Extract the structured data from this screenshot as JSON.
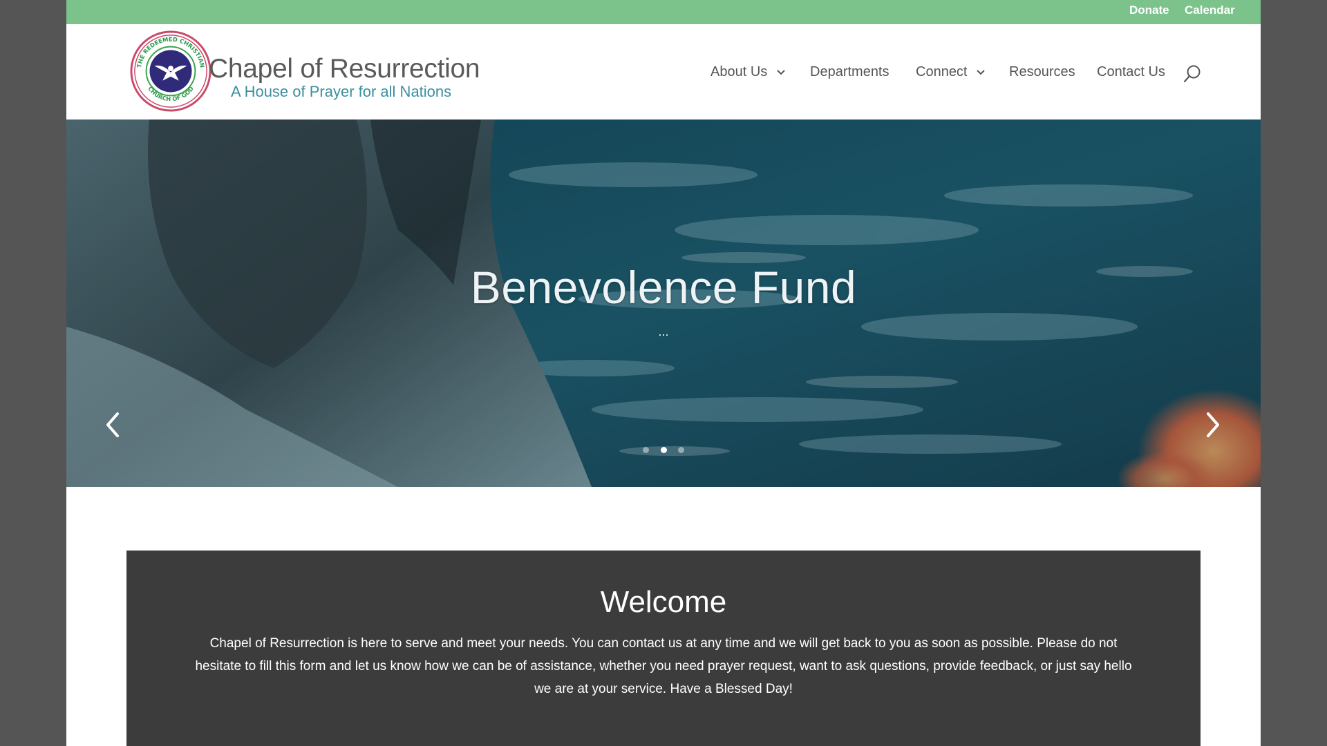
{
  "top_bar": {
    "links": [
      {
        "label": "Donate"
      },
      {
        "label": "Calendar"
      }
    ],
    "color": "#7cc38b"
  },
  "header": {
    "logo": {
      "title": "Chapel of Resurrection",
      "tagline": "A House of Prayer for all Nations",
      "seal_text_top": "THE REDEEMED CHRISTIAN",
      "seal_text_bottom": "CHURCH OF GOD"
    },
    "nav": [
      {
        "label": "About Us",
        "has_dropdown": true
      },
      {
        "label": "Departments",
        "has_dropdown": false
      },
      {
        "label": "Connect",
        "has_dropdown": true
      },
      {
        "label": "Resources",
        "has_dropdown": false
      },
      {
        "label": "Contact Us",
        "has_dropdown": false
      }
    ],
    "search_icon": "search-icon"
  },
  "hero": {
    "title": "Benevolence Fund",
    "subtitle": "...",
    "slide_count": 3,
    "active_slide": 2,
    "prev_icon": "chevron-left-icon",
    "next_icon": "chevron-right-icon"
  },
  "welcome": {
    "title": "Welcome",
    "body": "Chapel of Resurrection is here to serve and meet your needs. You can contact us at any time and we will get back to you as soon as possible. Please do not hesitate to fill this form and let us know how we can be of assistance, whether you need prayer request, want to ask questions, provide feedback, or just say hello we are at your service. Have a Blessed Day!"
  }
}
